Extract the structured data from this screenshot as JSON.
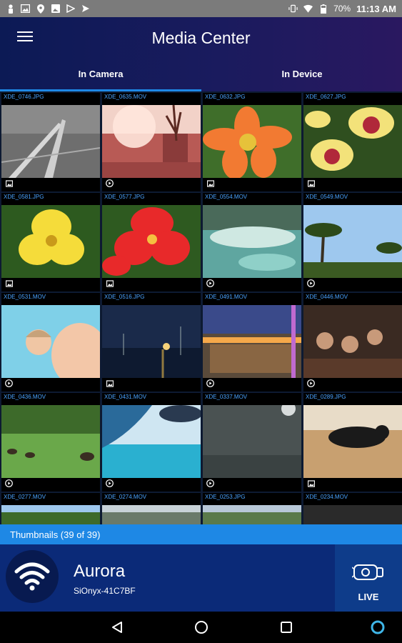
{
  "status_bar": {
    "icons_left": [
      "person-icon",
      "image-icon",
      "location-icon",
      "photo-icon",
      "play-store-icon",
      "send-icon"
    ],
    "icons_right": [
      "vibrate-icon",
      "wifi-icon",
      "battery-icon"
    ],
    "battery": "70%",
    "time": "11:13 AM"
  },
  "header": {
    "title": "Media Center",
    "tabs": [
      {
        "label": "In Camera",
        "selected": true
      },
      {
        "label": "In Device",
        "selected": false
      }
    ]
  },
  "grid": {
    "items": [
      {
        "name": "XDE_0746.JPG",
        "type": "photo"
      },
      {
        "name": "XDE_0635.MOV",
        "type": "video"
      },
      {
        "name": "XDE_0632.JPG",
        "type": "photo"
      },
      {
        "name": "XDE_0627.JPG",
        "type": "photo"
      },
      {
        "name": "XDE_0581.JPG",
        "type": "photo"
      },
      {
        "name": "XDE_0577.JPG",
        "type": "photo"
      },
      {
        "name": "XDE_0554.MOV",
        "type": "video"
      },
      {
        "name": "XDE_0549.MOV",
        "type": "video"
      },
      {
        "name": "XDE_0531.MOV",
        "type": "video"
      },
      {
        "name": "XDE_0516.JPG",
        "type": "photo"
      },
      {
        "name": "XDE_0491.MOV",
        "type": "video"
      },
      {
        "name": "XDE_0446.MOV",
        "type": "video"
      },
      {
        "name": "XDE_0436.MOV",
        "type": "video"
      },
      {
        "name": "XDE_0431.MOV",
        "type": "video"
      },
      {
        "name": "XDE_0337.MOV",
        "type": "video"
      },
      {
        "name": "XDE_0289.JPG",
        "type": "photo"
      },
      {
        "name": "XDE_0277.MOV",
        "type": "video"
      },
      {
        "name": "XDE_0274.MOV",
        "type": "video"
      },
      {
        "name": "XDE_0253.JPG",
        "type": "photo"
      },
      {
        "name": "XDE_0234.MOV",
        "type": "video"
      }
    ]
  },
  "thumbnails_label": "Thumbnails (39 of 39)",
  "device": {
    "name": "Aurora",
    "id": "SiOnyx-41C7BF",
    "live_label": "LIVE"
  },
  "colors": {
    "accent": "#1e88e5",
    "filename": "#4aa3ff",
    "panel": "#0b2a78"
  },
  "nav_bar": [
    "back-icon",
    "home-icon",
    "recents-icon",
    "assistant-icon"
  ]
}
